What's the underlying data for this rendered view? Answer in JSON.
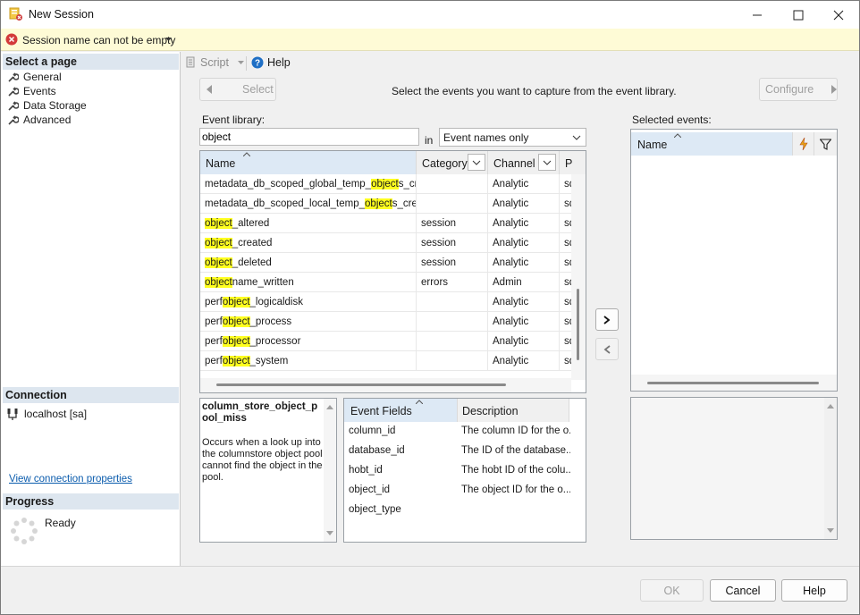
{
  "window": {
    "title": "New Session"
  },
  "notification": {
    "text": "Session name can not be empty"
  },
  "left_pane": {
    "select_page_header": "Select a page",
    "pages": [
      {
        "label": "General"
      },
      {
        "label": "Events"
      },
      {
        "label": "Data Storage"
      },
      {
        "label": "Advanced"
      }
    ],
    "connection_header": "Connection",
    "connection_server": "localhost [sa]",
    "view_connection_link": "View connection properties",
    "progress_header": "Progress",
    "progress_status": "Ready"
  },
  "toolbar": {
    "script_label": "Script",
    "help_label": "Help"
  },
  "events_page": {
    "select_button": "Select",
    "instruction": "Select the events you want to capture from the event library.",
    "configure_button": "Configure",
    "event_library_label": "Event library:",
    "search_value": "object",
    "in_label": "in",
    "search_scope": "Event names only",
    "selected_events_label": "Selected events:"
  },
  "library_grid": {
    "columns": [
      "Name",
      "Category",
      "Channel",
      "P"
    ],
    "rows": [
      {
        "name_pre": "metadata_db_scoped_global_temp_",
        "name_hl": "object",
        "name_post": "s_cre...",
        "category": "",
        "channel": "Analytic",
        "package": "sq"
      },
      {
        "name_pre": "metadata_db_scoped_local_temp_",
        "name_hl": "object",
        "name_post": "s_crea...",
        "category": "",
        "channel": "Analytic",
        "package": "sq"
      },
      {
        "name_pre": "",
        "name_hl": "object",
        "name_post": "_altered",
        "category": "session",
        "channel": "Analytic",
        "package": "sq"
      },
      {
        "name_pre": "",
        "name_hl": "object",
        "name_post": "_created",
        "category": "session",
        "channel": "Analytic",
        "package": "sq"
      },
      {
        "name_pre": "",
        "name_hl": "object",
        "name_post": "_deleted",
        "category": "session",
        "channel": "Analytic",
        "package": "sq"
      },
      {
        "name_pre": "",
        "name_hl": "object",
        "name_post": "name_written",
        "category": "errors",
        "channel": "Admin",
        "package": "sq"
      },
      {
        "name_pre": "perf",
        "name_hl": "object",
        "name_post": "_logicaldisk",
        "category": "",
        "channel": "Analytic",
        "package": "sq"
      },
      {
        "name_pre": "perf",
        "name_hl": "object",
        "name_post": "_process",
        "category": "",
        "channel": "Analytic",
        "package": "sq"
      },
      {
        "name_pre": "perf",
        "name_hl": "object",
        "name_post": "_processor",
        "category": "",
        "channel": "Analytic",
        "package": "sq"
      },
      {
        "name_pre": "perf",
        "name_hl": "object",
        "name_post": "_system",
        "category": "",
        "channel": "Analytic",
        "package": "sq"
      }
    ]
  },
  "selected_grid": {
    "name_header": "Name"
  },
  "description": {
    "event_name_line1": "column_store_object_p",
    "event_name_line2": "ool_miss",
    "text": "Occurs when a look up into the columnstore object pool cannot find the object in the pool."
  },
  "fields_grid": {
    "columns": [
      "Event Fields",
      "Description"
    ],
    "rows": [
      {
        "field": "column_id",
        "description": "The column ID for the o..."
      },
      {
        "field": "database_id",
        "description": "The ID of the database..."
      },
      {
        "field": "hobt_id",
        "description": "The hobt ID of the colu..."
      },
      {
        "field": "object_id",
        "description": "The object ID for the o..."
      },
      {
        "field": "object_type",
        "description": ""
      }
    ]
  },
  "footer": {
    "ok": "OK",
    "cancel": "Cancel",
    "help": "Help"
  },
  "colors": {
    "highlight": "#ffff20",
    "header_bg": "#dde6ef",
    "notify_bg": "#fefbd6",
    "link": "#0b5cad"
  }
}
